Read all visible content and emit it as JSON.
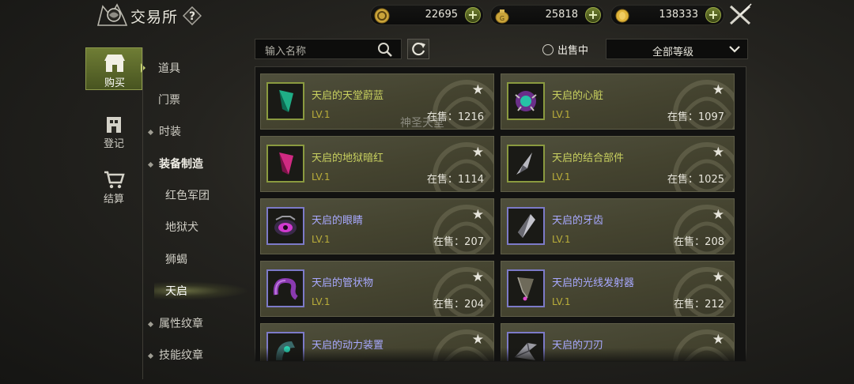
{
  "header": {
    "title": "交易所",
    "help_label": "?"
  },
  "currencies": [
    {
      "name": "gold-coin",
      "value": "22695",
      "plus": "+"
    },
    {
      "name": "gold-bag",
      "value": "25818",
      "plus": "+"
    },
    {
      "name": "gold-coins",
      "value": "138333",
      "plus": "+"
    }
  ],
  "left_nav": [
    {
      "label": "购买",
      "icon": "shop-icon",
      "active": true
    },
    {
      "label": "登记",
      "icon": "building-icon",
      "active": false
    },
    {
      "label": "结算",
      "icon": "cart-icon",
      "active": false
    }
  ],
  "categories": [
    {
      "label": "道具",
      "dot": false,
      "level": 0
    },
    {
      "label": "门票",
      "dot": false,
      "level": 0
    },
    {
      "label": "时装",
      "dot": true,
      "level": 0
    },
    {
      "label": "装备制造",
      "dot": true,
      "level": 0,
      "expanded": true
    },
    {
      "label": "红色军团",
      "dot": false,
      "level": 1
    },
    {
      "label": "地狱犬",
      "dot": false,
      "level": 1
    },
    {
      "label": "狮蝎",
      "dot": false,
      "level": 1
    },
    {
      "label": "天启",
      "dot": false,
      "level": 1,
      "selected": true
    },
    {
      "label": "属性纹章",
      "dot": true,
      "level": 0
    },
    {
      "label": "技能纹章",
      "dot": true,
      "level": 0
    }
  ],
  "search": {
    "placeholder": "输入名称"
  },
  "filter": {
    "on_sale_label": "出售中",
    "level_select": "全部等级"
  },
  "watermark": "神圣天堂",
  "items": [
    {
      "name": "天启的天堂蔚蓝",
      "level": "LV.1",
      "stock": "在售：1216",
      "rarity": "green",
      "icon": "teal-gem-icon"
    },
    {
      "name": "天启的心脏",
      "level": "LV.1",
      "stock": "在售：1097",
      "rarity": "green",
      "icon": "heart-icon"
    },
    {
      "name": "天启的地狱暗红",
      "level": "LV.1",
      "stock": "在售：1114",
      "rarity": "green",
      "icon": "crimson-gem-icon"
    },
    {
      "name": "天启的结合部件",
      "level": "LV.1",
      "stock": "在售：1025",
      "rarity": "green",
      "icon": "blade-part-icon"
    },
    {
      "name": "天启的眼睛",
      "level": "LV.1",
      "stock": "在售：207",
      "rarity": "purple",
      "icon": "eye-icon"
    },
    {
      "name": "天启的牙齿",
      "level": "LV.1",
      "stock": "在售：208",
      "rarity": "purple",
      "icon": "fang-icon"
    },
    {
      "name": "天启的管状物",
      "level": "LV.1",
      "stock": "在售：204",
      "rarity": "purple",
      "icon": "tube-icon"
    },
    {
      "name": "天启的光线发射器",
      "level": "LV.1",
      "stock": "在售：212",
      "rarity": "purple",
      "icon": "emitter-icon"
    },
    {
      "name": "天启的动力装置",
      "level": "",
      "stock": "",
      "rarity": "purple",
      "icon": "power-unit-icon"
    },
    {
      "name": "天启的刀刃",
      "level": "",
      "stock": "",
      "rarity": "purple",
      "icon": "blade-icon"
    }
  ],
  "star_glyph": "★"
}
